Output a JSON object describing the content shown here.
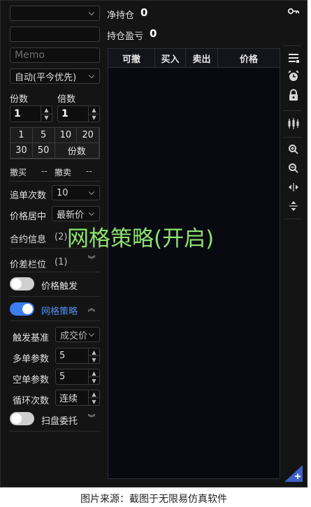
{
  "header": {
    "net_position_label": "净持仓",
    "net_position_value": "0",
    "pnl_label": "持仓盈亏",
    "pnl_value": "0"
  },
  "controls": {
    "account_select_value": "",
    "memo_placeholder": "Memo",
    "mode_select_value": "自动(平今优先)",
    "qty_label": "份数",
    "qty_value": "1",
    "mult_label": "倍数",
    "mult_value": "1"
  },
  "quick_qty": [
    "1",
    "5",
    "10",
    "20",
    "30",
    "50",
    "份数"
  ],
  "cancel": {
    "buy_label": "撤买",
    "buy_value": "--",
    "sell_label": "撤卖",
    "sell_value": "--"
  },
  "chase": {
    "label": "追单次数",
    "value": "10"
  },
  "price_mid": {
    "label": "价格居中",
    "value": "最新价"
  },
  "sections": {
    "contract_info": "合约信息",
    "contract_info_count": "(2)",
    "spread_position": "价差栏位",
    "spread_position_count": "(1)",
    "price_trigger": "价格触发",
    "grid_strategy": "网格策略",
    "sweep_order": "扫盘委托"
  },
  "grid_settings": {
    "trigger_base_label": "触发基准",
    "trigger_base_value": "成交价",
    "long_param_label": "多单参数",
    "long_param_value": "5",
    "short_param_label": "空单参数",
    "short_param_value": "5",
    "loop_label": "循环次数",
    "loop_value": "连续"
  },
  "toggles": {
    "price_trigger": false,
    "grid_strategy": true,
    "sweep_order": false
  },
  "table": {
    "columns": [
      "可撤",
      "买入",
      "卖出",
      "价格"
    ]
  },
  "toolbar_icons": [
    "key-icon",
    "menu-lines-icon",
    "alarm-clock-icon",
    "lock-icon",
    "candlestick-icon",
    "zoom-in-icon",
    "zoom-out-icon",
    "expand-horizontal-icon",
    "expand-vertical-icon",
    "add-icon"
  ],
  "overlay_title": "网格策略(开启)",
  "caption": "图片来源：截图于无限易仿真软件",
  "colors": {
    "accent": "#3c7ef0",
    "overlay": "#8de36e",
    "background": "#141414"
  }
}
